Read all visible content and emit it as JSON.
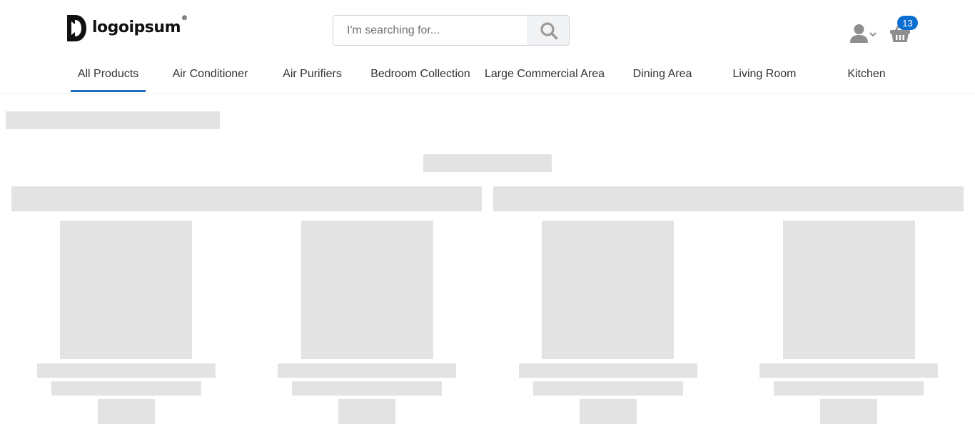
{
  "brand": {
    "name": "logoipsum",
    "mark": "®"
  },
  "search": {
    "placeholder": "I'm searching for...",
    "value": ""
  },
  "cart": {
    "count": "13"
  },
  "icons": {
    "search": "search-icon",
    "account": "user-icon",
    "account_menu": "chevron-down-icon",
    "cart": "basket-icon"
  },
  "colors": {
    "accent": "#0a6fd1",
    "active_tab_underline": "#1f6fbf",
    "skeleton": "#e3e3e3"
  },
  "nav": {
    "items": [
      {
        "label": "All Products",
        "active": true
      },
      {
        "label": "Air Conditioner",
        "active": false
      },
      {
        "label": "Air Purifiers",
        "active": false
      },
      {
        "label": "Bedroom Collection",
        "active": false
      },
      {
        "label": "Large Commercial Area",
        "active": false
      },
      {
        "label": "Dining Area",
        "active": false
      },
      {
        "label": "Living Room",
        "active": false
      },
      {
        "label": "Kitchen",
        "active": false
      }
    ]
  },
  "content": {
    "state": "loading"
  }
}
